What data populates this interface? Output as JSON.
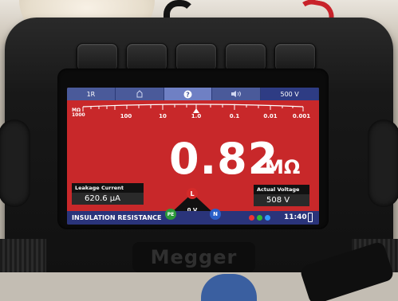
{
  "screen": {
    "top_tabs": [
      "1R",
      "",
      "?",
      "",
      "500 V"
    ],
    "scale": {
      "unit_top": "MΩ",
      "unit_bottom": "1000",
      "labels": [
        "100",
        "10",
        "1.0",
        "0.1",
        "0.01",
        "0.001"
      ]
    },
    "reading": "0.82",
    "reading_unit": "MΩ",
    "leakage": {
      "label": "Leakage Current",
      "value": "620.6 μA"
    },
    "voltage": {
      "label": "Actual Voltage",
      "value": "508 V"
    },
    "dial": {
      "l": "L",
      "pe": "PE",
      "n": "N",
      "center": "0 V"
    },
    "status": {
      "mode": "INSULATION RESISTANCE",
      "time": "11:40"
    }
  },
  "brand": "Megger"
}
